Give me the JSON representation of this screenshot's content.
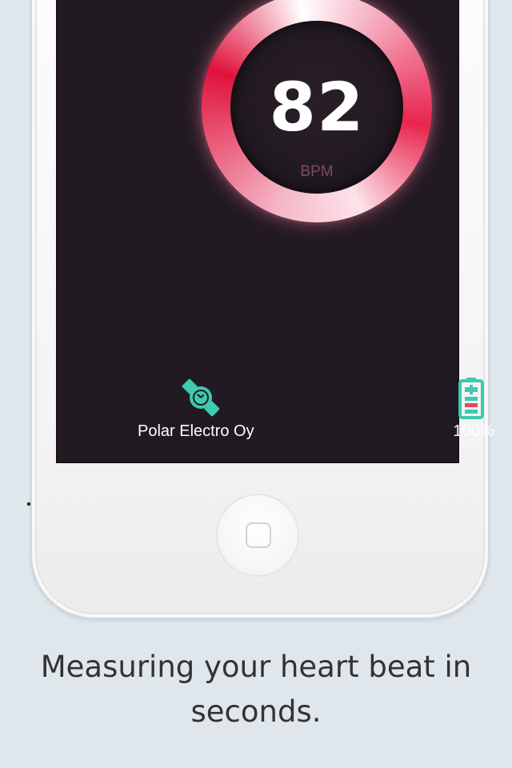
{
  "heart_rate": {
    "value": "82",
    "unit": "BPM"
  },
  "device": {
    "icon": "watch-icon",
    "name": "Polar Electro Oy"
  },
  "battery": {
    "icon": "battery-icon",
    "level": "100%"
  },
  "caption": {
    "text": "Measuring your heart beat in seconds."
  },
  "colors": {
    "background": "#dfe7ec",
    "screen": "#221a22",
    "ring_accent": "#e0123c",
    "icon_teal": "#3fc9ae",
    "caption_text": "#333333"
  }
}
